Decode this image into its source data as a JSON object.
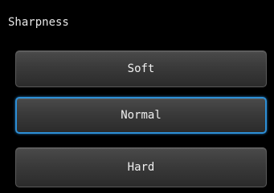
{
  "screen": {
    "title": "Sharpness"
  },
  "options": [
    {
      "label": "Soft",
      "selected": false
    },
    {
      "label": "Normal",
      "selected": true
    },
    {
      "label": "Hard",
      "selected": false
    }
  ],
  "colors": {
    "background": "#000000",
    "button_top": "#4a4a4a",
    "button_bottom": "#2b2b2b",
    "selection_highlight": "#2d8fd6",
    "text": "#f0f0f0"
  }
}
